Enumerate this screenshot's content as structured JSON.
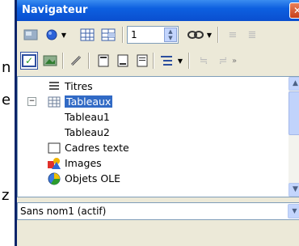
{
  "background_text": [
    "n",
    "e",
    "z"
  ],
  "window": {
    "title": "Navigateur",
    "close_label": "✕"
  },
  "toolbar1": {
    "page_value": "1"
  },
  "tree": {
    "items": [
      {
        "label": "Titres"
      },
      {
        "label": "Tableaux"
      },
      {
        "label": "Tableau1"
      },
      {
        "label": "Tableau2"
      },
      {
        "label": "Cadres texte"
      },
      {
        "label": "Images"
      },
      {
        "label": "Objets OLE"
      }
    ]
  },
  "document_selector": {
    "value": "Sans nom1 (actif)"
  },
  "colors": {
    "titlebar": "#0d5fe0",
    "selection": "#316ac5",
    "dialog_bg": "#ece9d8"
  }
}
